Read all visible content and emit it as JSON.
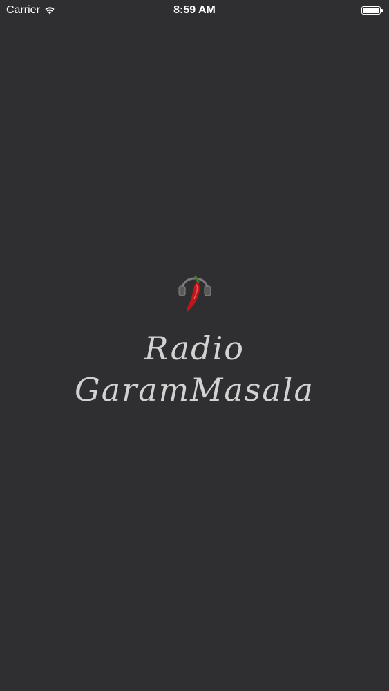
{
  "status_bar": {
    "carrier": "Carrier",
    "time": "8:59 AM",
    "battery_level": 1.0,
    "icons": [
      "wifi-icon",
      "battery-icon"
    ]
  },
  "splash": {
    "logo_icon": "chili-headphones-icon",
    "title_line1": "Radio",
    "title_line2": "GaramMasala"
  },
  "colors": {
    "background": "#2f2e30",
    "text": "#d2d2d2",
    "chili": "#c0161a"
  }
}
